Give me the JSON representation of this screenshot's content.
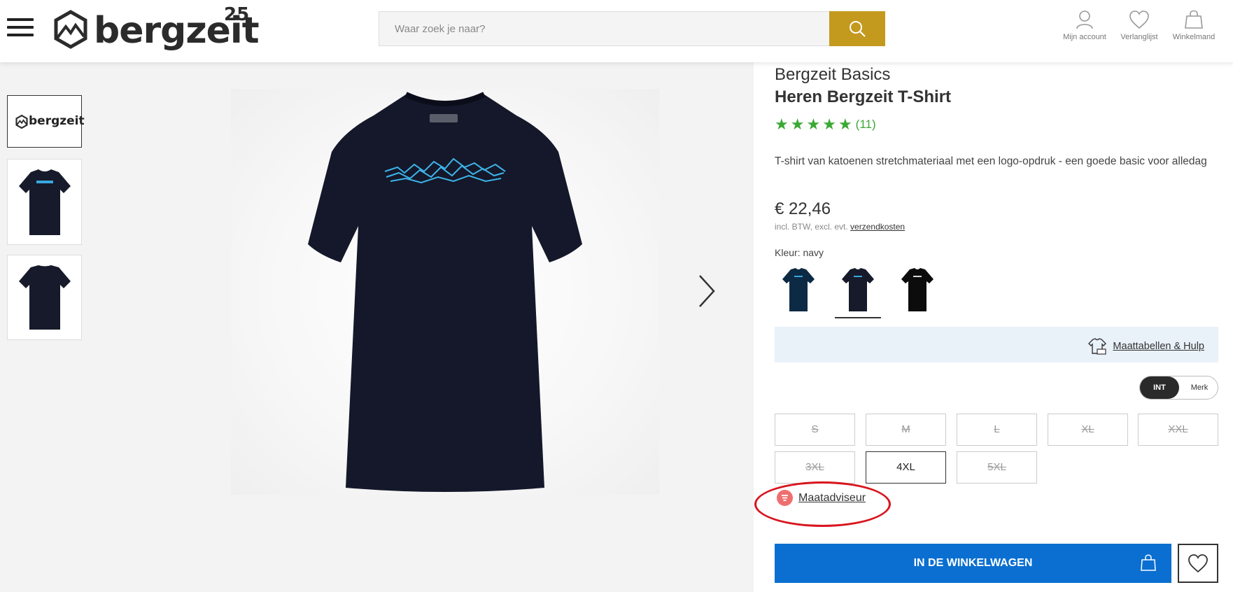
{
  "header": {
    "logo_text": "bergzeit",
    "logo_sup": "25",
    "search_placeholder": "Waar zoek je naar?",
    "account_label": "Mijn account",
    "wishlist_label": "Verlanglijst",
    "cart_label": "Winkelmand"
  },
  "gallery": {
    "thumb_logo_text": "bergzeit"
  },
  "product": {
    "brand": "Bergzeit Basics",
    "title": "Heren Bergzeit T-Shirt",
    "rating_stars": 5,
    "rating_count": "(11)",
    "description": "T-shirt van katoenen stretchmateriaal met een logo-opdruk - een goede basic voor alledag",
    "price": "€ 22,46",
    "price_note": "incl. BTW, excl. evt.",
    "shipping_link": "verzendkosten",
    "color_label": "Kleur: navy",
    "colors": [
      {
        "name": "petrol",
        "hex": "#0d2a44"
      },
      {
        "name": "navy",
        "hex": "#161a2a",
        "selected": true
      },
      {
        "name": "black",
        "hex": "#0c0c0c"
      }
    ],
    "size_help_link": "Maattabellen & Hulp",
    "size_toggle": {
      "int": "INT",
      "merk": "Merk"
    },
    "sizes": [
      {
        "label": "S",
        "available": false
      },
      {
        "label": "M",
        "available": false
      },
      {
        "label": "L",
        "available": false
      },
      {
        "label": "XL",
        "available": false
      },
      {
        "label": "XXL",
        "available": false
      },
      {
        "label": "3XL",
        "available": false
      },
      {
        "label": "4XL",
        "available": true
      },
      {
        "label": "5XL",
        "available": false
      }
    ],
    "size_advisor": "Maatadviseur",
    "add_to_cart": "IN DE WINKELWAGEN"
  },
  "colors": {
    "accent_gold": "#c49a1e",
    "cart_blue": "#0a6fd0",
    "rating_green": "#3aa835",
    "highlight_red": "#d8151e"
  }
}
